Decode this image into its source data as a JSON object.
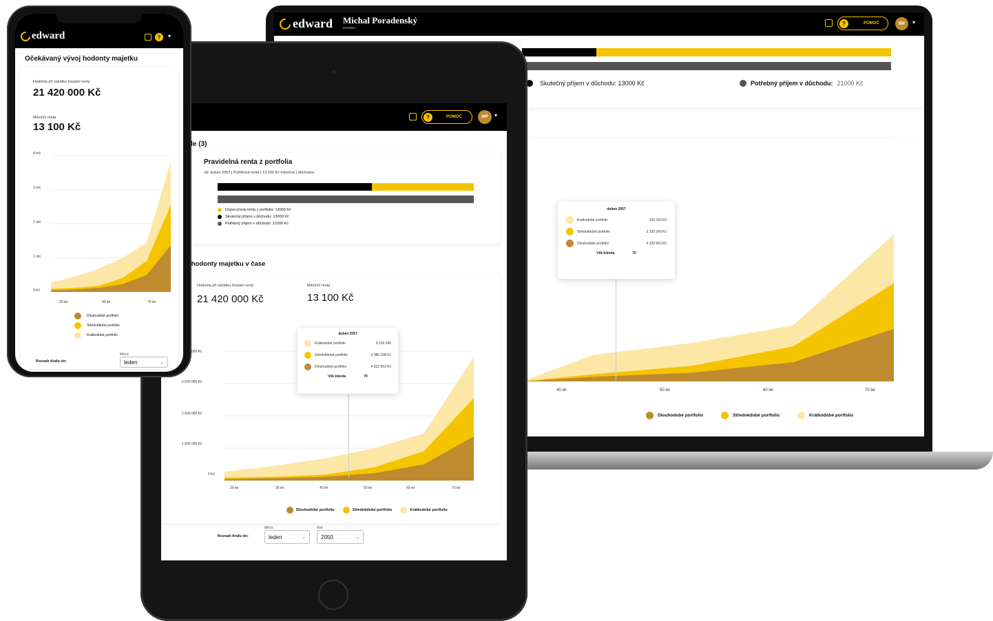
{
  "brand": {
    "logo": "edward",
    "accent": "#f5c400",
    "dark": "#c08a2e",
    "light": "#fde7a6"
  },
  "header": {
    "help": "POMOC",
    "avatar": "MP",
    "advisor_name": "Michal Poradenský",
    "advisor_role": "poradce"
  },
  "laptop": {
    "legend_top": {
      "actual": "Skutečný příjem v důchodu: 13000 Kč",
      "needed_label": "Potřebný příjem v důchodu:",
      "needed_value": "21000 Kč"
    },
    "tooltip": {
      "title": "duben 2057",
      "rows": [
        {
          "label": "Krátkodobé portfolio",
          "value": "333 333 Kč"
        },
        {
          "label": "Střednědobé portfolio",
          "value": "3 333 343 Kč"
        },
        {
          "label": "Dlouhodobé portfolio",
          "value": "4 332 963 Kč"
        }
      ],
      "age_label": "Věk klienta",
      "age_value": "70"
    },
    "x_ticks": [
      "40 let",
      "50 let",
      "60 let",
      "70 let"
    ],
    "legend": [
      "Dlouhodobé portfolio",
      "Střednědobé portfolio",
      "Krátkodobé portfolio"
    ]
  },
  "tablet": {
    "goals_heading": "Nastavené cíle (3)",
    "goal_title": "Pravidelná renta z portfolia",
    "goal_sub": "od: duben 2057 | Požitková renta | 13 100 Kč měsíčně | důchodce",
    "bullets": [
      "Doporučená renta z portfolia: 13000 Kč",
      "Skutečný příjem v důchodu: 13000 Kč",
      "Potřebný příjem v důchodu: 21000 Kč"
    ],
    "chart_heading": "Očekávaný vývoj hodonty majetku v čase",
    "value_label": "Hodnota při začátku čerpání renty",
    "value": "21 420 000 Kč",
    "rent_label": "Měsíční renta",
    "rent": "13 100 Kč",
    "y_ticks": [
      "3 600 000 Kč",
      "2 600 000 Kč",
      "2 600 000 Kč",
      "1 600 000 Kč",
      "0 Kč"
    ],
    "x_ticks": [
      "20 let",
      "30 let",
      "40 let",
      "50 let",
      "60 let",
      "70 let"
    ],
    "tooltip": {
      "title": "duben 2057",
      "rows": [
        {
          "label": "Krátkodobé portfolio",
          "value": "3 016 045"
        },
        {
          "label": "Střednědobé portfolio",
          "value": "3 086 338 Kč"
        },
        {
          "label": "Dlouhodobé portfolio",
          "value": "4 332 963 Kč"
        }
      ],
      "age_label": "Věk klienta",
      "age_value": "70"
    },
    "legend": [
      "Dlouhodobé portfolio",
      "Střednědobé portfolio",
      "Krátkodobé portfolio"
    ],
    "range_label": "Rozsah tlrafu do:",
    "month_label": "Měsíc",
    "month_value": "leden",
    "year_label": "Rok",
    "year_value": "2050"
  },
  "phone": {
    "heading": "Očekávaný vývoj hodonty majetku",
    "value_label": "Hodnota při začátku čerpání renty",
    "value": "21 420 000 Kč",
    "rent_label": "Měsíční renta",
    "rent": "13 100 Kč",
    "y_ticks": [
      "4 mil.",
      "3 mil.",
      "2 mil.",
      "1 mil.",
      "0 Kč"
    ],
    "x_ticks": [
      "20 let",
      "40 let",
      "70 let"
    ],
    "legend": [
      "Dlouhodobé portfolio",
      "Střednědobé portfolio",
      "Krátkodobé portfolio"
    ],
    "range_label": "Rozsah tlrafu do:",
    "month_label": "Měsíc",
    "month_value": "leden"
  },
  "chart_data": {
    "type": "area",
    "title": "Očekávaný vývoj hodonty majetku v čase",
    "x": [
      20,
      30,
      40,
      50,
      60,
      70
    ],
    "xlabel": "",
    "ylabel": "",
    "stacked": true,
    "series": [
      {
        "name": "Dlouhodobé portfolio",
        "values": [
          0.05,
          0.08,
          0.13,
          0.25,
          0.55,
          1.5
        ]
      },
      {
        "name": "Střednědobé portfolio",
        "values": [
          0.1,
          0.13,
          0.2,
          0.45,
          1.0,
          2.8
        ]
      },
      {
        "name": "Krátkodobé portfolio",
        "values": [
          0.3,
          0.5,
          0.75,
          1.1,
          1.6,
          4.2
        ]
      }
    ],
    "ylim": [
      0,
      4.4
    ],
    "grid": true,
    "legend": "bottom"
  }
}
